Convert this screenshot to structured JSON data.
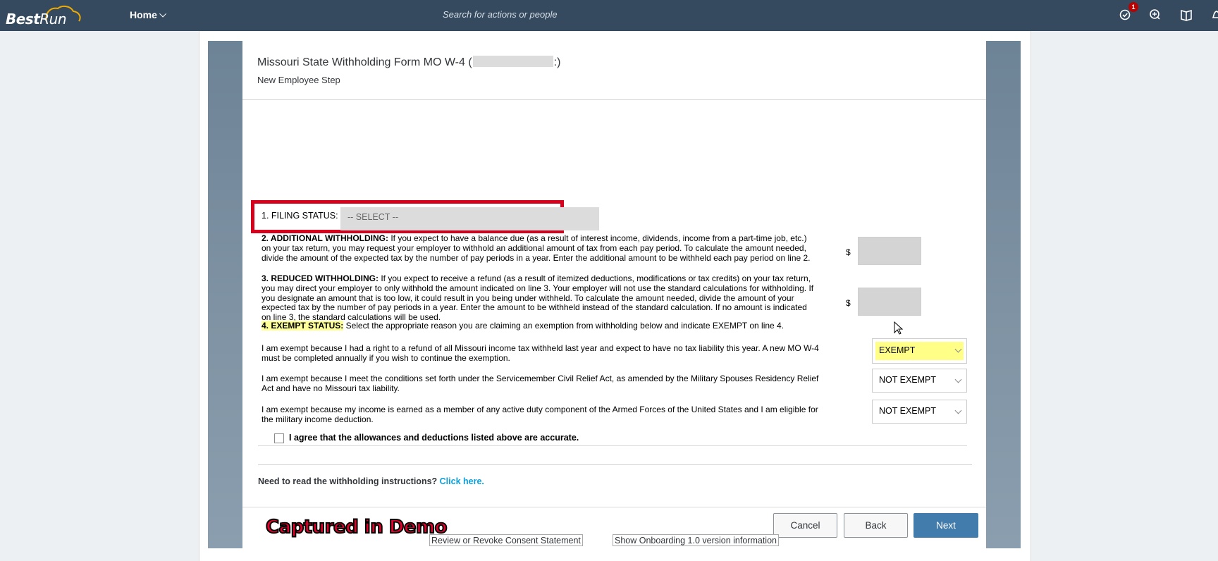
{
  "shell": {
    "logo_best": "Best",
    "logo_run": "Run",
    "home_label": "Home",
    "search_placeholder": "Search for actions or people",
    "notification_count": "1"
  },
  "dialog": {
    "title_prefix": "Missouri State Withholding Form MO W-4 (",
    "title_suffix": ":)",
    "subtitle": "New Employee Step",
    "filing_status_label": "1. FILING STATUS:",
    "filing_status_value": "-- SELECT --",
    "para2_heading": "2. ADDITIONAL WITHHOLDING:",
    "para2_text": "If you expect to have a balance due (as a result of interest income, dividends, income from a part-time job, etc.) on your tax return, you may request your employer to withhold an additional amount of tax from each pay period. To calculate the amount needed, divide the amount of the expected tax by the number of pay periods in a year. Enter the additional amount to be withheld each pay period on line 2.",
    "para3_heading": "3. REDUCED WITHHOLDING:",
    "para3_text": "If you expect to receive a refund (as a result of itemized deductions, modifications or tax credits) on your tax return, you may direct your employer to only withhold the amount indicated on line 3. Your employer will not use the standard calculations for withholding. If you designate an amount that is too low, it could result in you being under withheld. To calculate the amount needed, divide the amount of your expected tax by the number of pay periods in a year. Enter the amount to be withheld instead of the standard calculation. If no amount is indicated on line 3, the standard calculations will be used.",
    "para4_heading": "4. EXEMPT STATUS:",
    "para4_text": "Select the appropriate reason you are claiming an exemption from withholding below and indicate EXEMPT on line 4.",
    "currency_symbol": "$",
    "exempt_rows": [
      {
        "text": "I am exempt because I had a right to a refund of all Missouri income tax withheld last year and expect to have no tax liability this year. A new MO W-4 must be completed annually if you wish to continue the exemption.",
        "value": "EXEMPT"
      },
      {
        "text": "I am exempt because I meet the conditions set forth under the Servicemember Civil Relief Act, as amended by the Military Spouses Residency Relief Act and have no Missouri tax liability.",
        "value": "NOT EXEMPT"
      },
      {
        "text": "I am exempt because my income is earned as a member of any active duty component of the Armed Forces of the United States and I am eligible for the military income deduction.",
        "value": "NOT EXEMPT"
      }
    ],
    "agree_label": "I agree that the allowances and deductions listed above are accurate.",
    "instructions_text": "Need to read the withholding instructions?",
    "instructions_link": "Click here.",
    "buttons": {
      "cancel": "Cancel",
      "back": "Back",
      "next": "Next"
    }
  },
  "watermark": "Captured in Demo",
  "bottom_links": {
    "consent": "Review or Revoke Consent Statement",
    "version": "Show Onboarding 1.0 version information"
  },
  "colors": {
    "shell_bg": "#354a5f",
    "accent_button": "#427cac",
    "highlight_red": "#d6001c",
    "highlight_yellow": "#ffff99",
    "link": "#0a9fd9"
  }
}
